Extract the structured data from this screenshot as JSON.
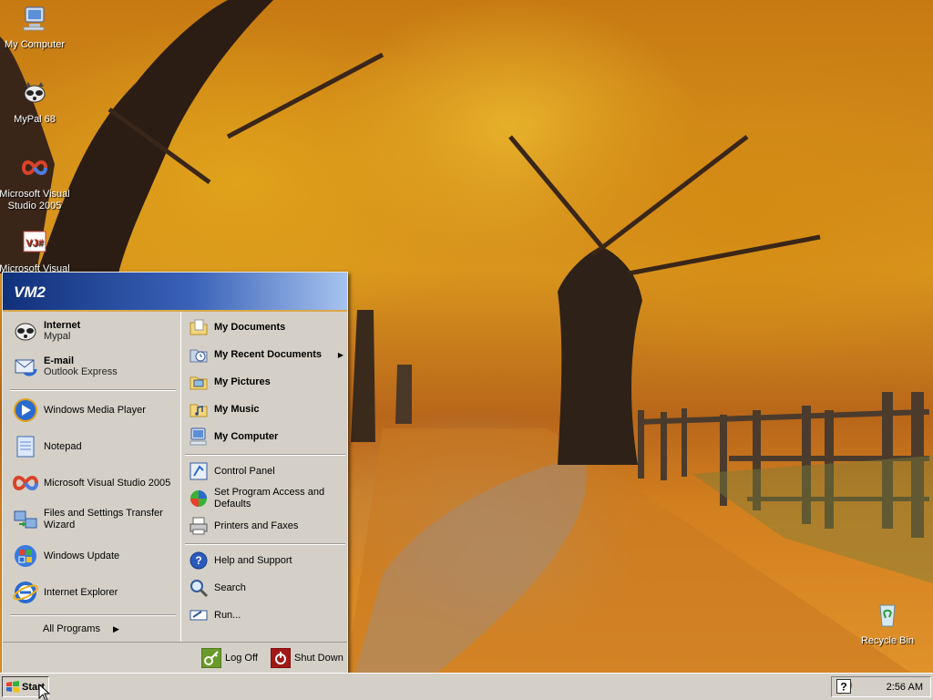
{
  "desktop": {
    "icons": [
      {
        "label": "My Computer"
      },
      {
        "label": "MyPal 68"
      },
      {
        "label": "Microsoft Visual Studio 2005"
      },
      {
        "label": "Microsoft Visual"
      },
      {
        "label": "Recycle Bin"
      }
    ]
  },
  "start_menu": {
    "user": "VM2",
    "pinned": [
      {
        "title": "Internet",
        "subtitle": "Mypal"
      },
      {
        "title": "E-mail",
        "subtitle": "Outlook Express"
      }
    ],
    "recent": [
      {
        "label": "Windows Media Player"
      },
      {
        "label": "Notepad"
      },
      {
        "label": "Microsoft Visual Studio 2005"
      },
      {
        "label": "Files and Settings Transfer Wizard"
      },
      {
        "label": "Windows Update"
      },
      {
        "label": "Internet Explorer"
      }
    ],
    "all_programs": "All Programs",
    "places": [
      {
        "label": "My Documents"
      },
      {
        "label": "My Recent Documents"
      },
      {
        "label": "My Pictures"
      },
      {
        "label": "My Music"
      },
      {
        "label": "My Computer"
      }
    ],
    "settings": [
      {
        "label": "Control Panel"
      },
      {
        "label": "Set Program Access and Defaults"
      },
      {
        "label": "Printers and Faxes"
      }
    ],
    "tools": [
      {
        "label": "Help and Support"
      },
      {
        "label": "Search"
      },
      {
        "label": "Run..."
      }
    ],
    "log_off": "Log Off",
    "shut_down": "Shut Down"
  },
  "taskbar": {
    "start_label": "Start",
    "clock": "2:56 AM"
  }
}
